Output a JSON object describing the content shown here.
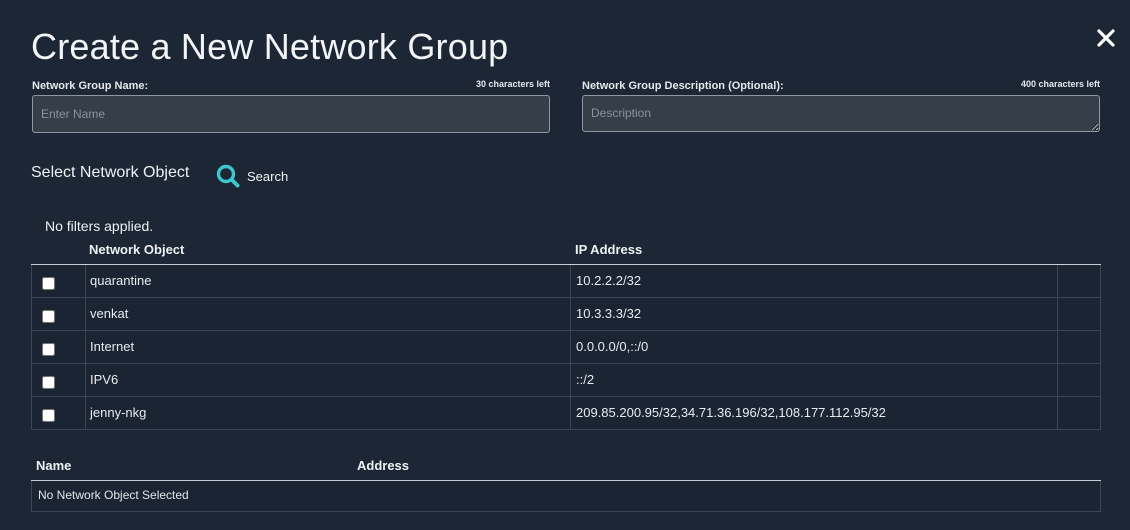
{
  "dialog": {
    "title": "Create a New Network Group",
    "close_icon": "close-icon"
  },
  "name_field": {
    "label": "Network Group Name:",
    "chars_left": "30 characters left",
    "placeholder": "Enter Name",
    "value": ""
  },
  "description_field": {
    "label": "Network Group Description (Optional):",
    "chars_left": "400 characters left",
    "placeholder": "Description",
    "value": ""
  },
  "select_section": {
    "label": "Select Network Object",
    "search_label": "Search",
    "search_icon": "search-icon",
    "filters_text": "No filters applied."
  },
  "objects_table": {
    "columns": [
      "Network Object",
      "IP Address"
    ],
    "rows": [
      {
        "name": "quarantine",
        "ip": "10.2.2.2/32",
        "checked": false
      },
      {
        "name": "venkat",
        "ip": "10.3.3.3/32",
        "checked": false
      },
      {
        "name": "Internet",
        "ip": "0.0.0.0/0,::/0",
        "checked": false
      },
      {
        "name": "IPV6",
        "ip": "::/2",
        "checked": false
      },
      {
        "name": "jenny-nkg",
        "ip": "209.85.200.95/32,34.71.36.196/32,108.177.112.95/32",
        "checked": false
      }
    ]
  },
  "selected_table": {
    "columns": [
      "Name",
      "Address"
    ],
    "empty_text": "No Network Object Selected"
  },
  "colors": {
    "background": "#1d2634",
    "input_background": "#363e49",
    "search_icon": "#3ec7cf",
    "text": "#e8ecf1"
  }
}
